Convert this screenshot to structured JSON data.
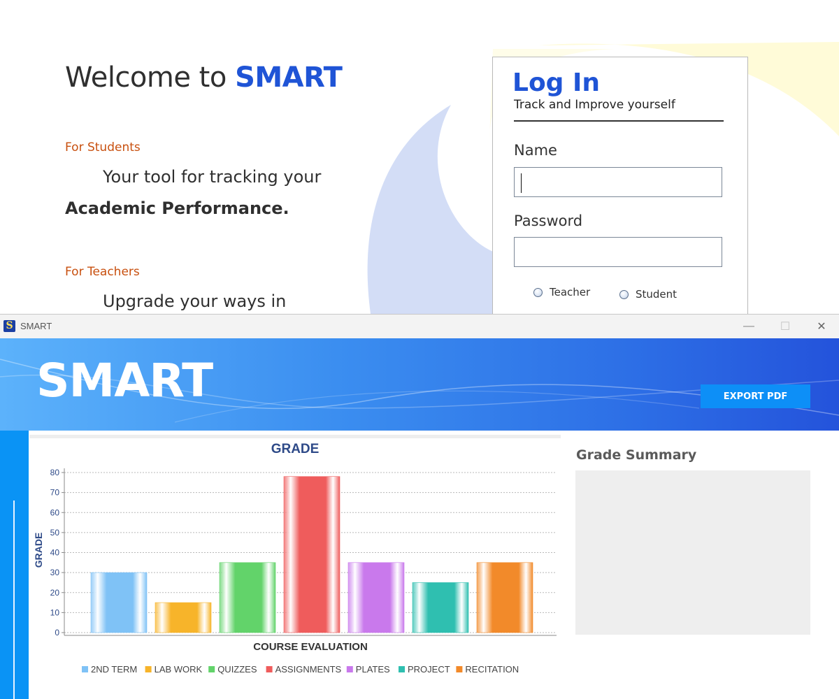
{
  "login_screen": {
    "welcome_prefix": "Welcome to ",
    "welcome_brand": "SMART",
    "students_label": "For Students",
    "students_line1": "Your tool for tracking your",
    "students_line2": "Academic Performance.",
    "teachers_label": "For Teachers",
    "teachers_line1": "Upgrade your ways in",
    "panel": {
      "title": "Log In",
      "subtitle": "Track and Improve yourself",
      "name_label": "Name",
      "name_value": "",
      "password_label": "Password",
      "password_value": "",
      "radio_teacher": "Teacher",
      "radio_student": "Student"
    }
  },
  "window": {
    "title": "SMART",
    "minimize": "—",
    "maximize": "☐",
    "close": "✕"
  },
  "banner": {
    "logo": "SMART",
    "export_label": "EXPORT PDF"
  },
  "summary": {
    "title": "Grade Summary"
  },
  "colors": {
    "brand_blue": "#1f54d6",
    "section_orange": "#c8500f",
    "export_button": "#0d8ff7",
    "side_strip": "#0a93f5",
    "chart_title": "#2e4a88"
  },
  "chart_data": {
    "type": "bar",
    "title": "GRADE",
    "xlabel": "COURSE EVALUATION",
    "ylabel": "GRADE",
    "ylim": [
      0,
      80
    ],
    "yticks": [
      0,
      10,
      20,
      30,
      40,
      50,
      60,
      70,
      80
    ],
    "grid": true,
    "legend_position": "bottom",
    "series": [
      {
        "name": "2ND TERM",
        "value": 30,
        "color": "#7fc2f6"
      },
      {
        "name": "LAB WORK",
        "value": 15,
        "color": "#f7b42a"
      },
      {
        "name": "QUIZZES",
        "value": 35,
        "color": "#62d36a"
      },
      {
        "name": "ASSIGNMENTS",
        "value": 78,
        "color": "#ef5c5c"
      },
      {
        "name": "PLATES",
        "value": 35,
        "color": "#c979ec"
      },
      {
        "name": "PROJECT",
        "value": 25,
        "color": "#2fbfb0"
      },
      {
        "name": "RECITATION",
        "value": 35,
        "color": "#f28a2a"
      }
    ]
  }
}
